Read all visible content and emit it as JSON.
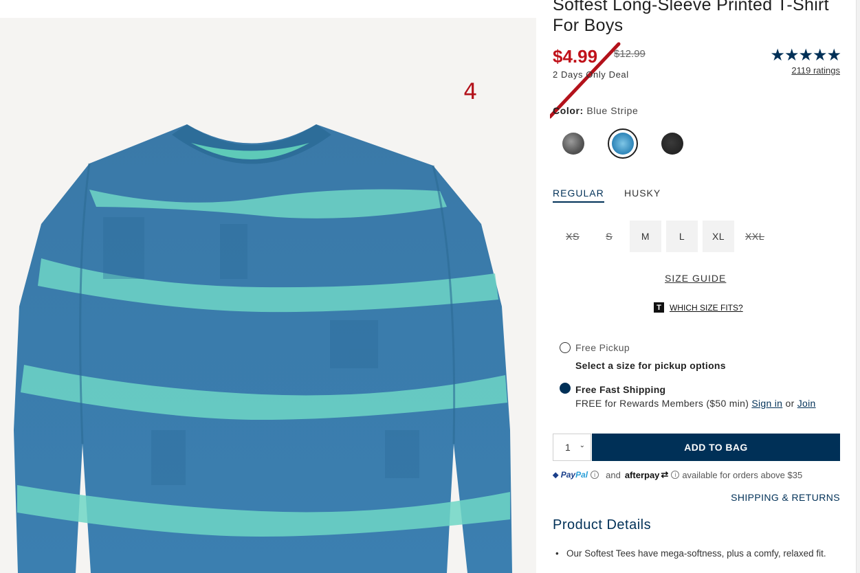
{
  "product": {
    "title": "Softest Long-Sleeve Printed T-Shirt For Boys",
    "sale_price": "$4.99",
    "original_price": "$12.99",
    "deal_text": "2 Days Only Deal",
    "stars": "★★★★★",
    "rating_value": 5,
    "ratings_link": "2119 ratings",
    "annotation_number": "4"
  },
  "color": {
    "label": "Color:",
    "selected": "Blue Stripe",
    "swatches": [
      "gray-tie-dye",
      "blue-stripe",
      "black"
    ]
  },
  "fit_tabs": [
    {
      "label": "REGULAR",
      "active": true
    },
    {
      "label": "HUSKY",
      "active": false
    }
  ],
  "sizes": [
    {
      "label": "XS",
      "available": false
    },
    {
      "label": "S",
      "available": false
    },
    {
      "label": "M",
      "available": true
    },
    {
      "label": "L",
      "available": true
    },
    {
      "label": "XL",
      "available": true
    },
    {
      "label": "XXL",
      "available": false
    }
  ],
  "size_guide": "SIZE GUIDE",
  "which_size": {
    "icon": "T",
    "label": "WHICH SIZE FITS?"
  },
  "fulfillment": {
    "pickup_label": "Free Pickup",
    "pickup_sub": "Select a size for pickup options",
    "shipping_label": "Free Fast Shipping",
    "shipping_sub_prefix": "FREE for Rewards Members ($50 min)",
    "sign_in": "Sign in",
    "or": "or",
    "join": "Join"
  },
  "cart": {
    "quantity": "1",
    "add_to_bag": "ADD TO BAG"
  },
  "payment": {
    "paypal_a": "Pay",
    "paypal_b": "Pal",
    "and": "and",
    "afterpay": "afterpay",
    "available_text": "available for orders above $35"
  },
  "shipping_returns": "SHIPPING & RETURNS",
  "details": {
    "title": "Product Details",
    "items": [
      "Our Softest Tees have mega-softness, plus a comfy, relaxed fit."
    ]
  },
  "colors": {
    "accent_navy": "#003057",
    "sale_red": "#c0121a",
    "annotation_red": "#b3121b"
  }
}
